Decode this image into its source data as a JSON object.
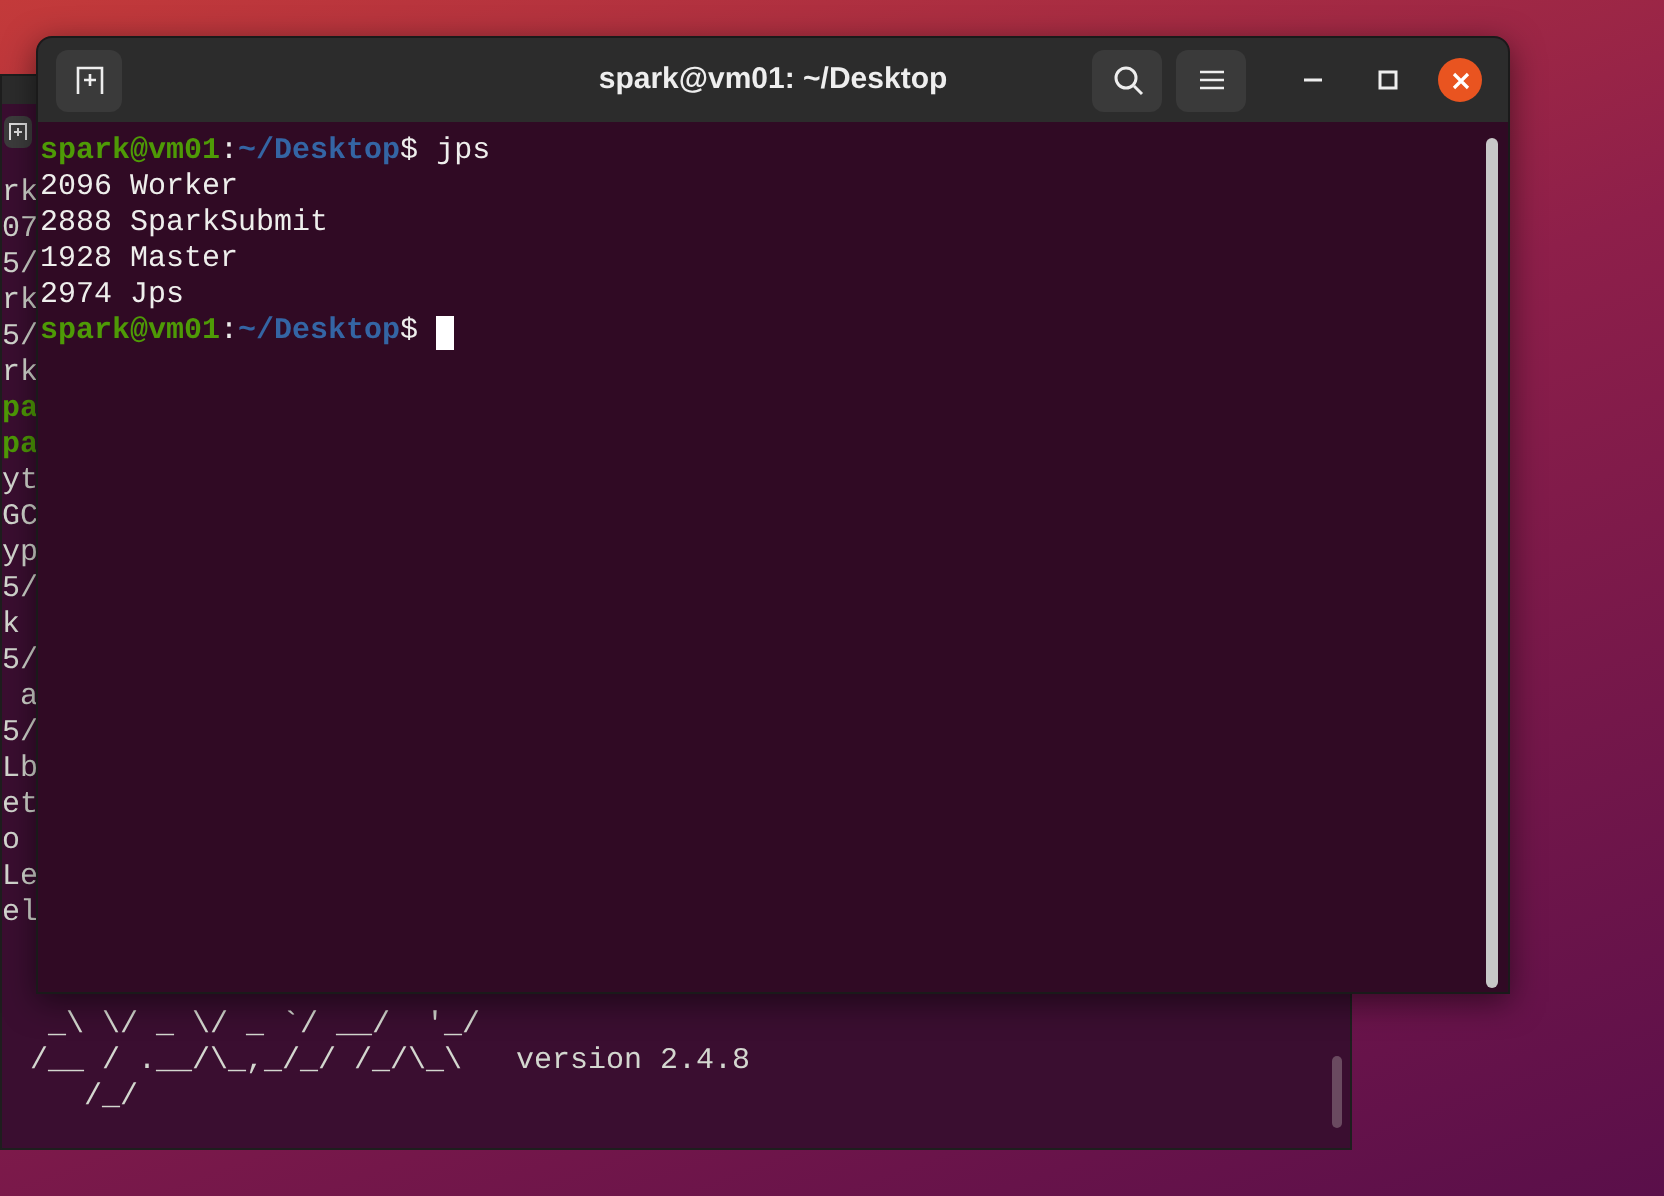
{
  "background_terminal": {
    "lines": [
      {
        "kind": "plain",
        "text": "rk"
      },
      {
        "kind": "plain",
        "text": "07"
      },
      {
        "kind": "plain",
        "text": "5/"
      },
      {
        "kind": "plain",
        "text": "rk"
      },
      {
        "kind": "plain",
        "text": "5/"
      },
      {
        "kind": "plain",
        "text": "rk"
      },
      {
        "kind": "prompt",
        "text": "pa"
      },
      {
        "kind": "prompt",
        "text": "pa"
      },
      {
        "kind": "plain",
        "text": "yt"
      },
      {
        "kind": "plain",
        "text": "GC"
      },
      {
        "kind": "plain",
        "text": "yp"
      },
      {
        "kind": "plain",
        "text": "5/"
      },
      {
        "kind": "plain",
        "text": "k"
      },
      {
        "kind": "plain",
        "text": "5/"
      },
      {
        "kind": "plain",
        "text": " a"
      },
      {
        "kind": "plain",
        "text": "5/"
      },
      {
        "kind": "plain",
        "text": "Lb"
      },
      {
        "kind": "plain",
        "text": "et"
      },
      {
        "kind": "plain",
        "text": "o"
      },
      {
        "kind": "plain",
        "text": "Le"
      },
      {
        "kind": "plain",
        "text": "el"
      }
    ],
    "banner": [
      " _\\ \\/ _ \\/ _ `/ __/  '_/",
      "/__ / .__/\\_,_/_/ /_/\\_\\   version 2.4.8",
      "   /_/"
    ]
  },
  "window": {
    "title": "spark@vm01: ~/Desktop"
  },
  "terminal": {
    "lines": [
      {
        "kind": "prompt",
        "user_host": "spark@vm01",
        "separator": ":",
        "path": "~/Desktop",
        "symbol": "$",
        "command": " jps",
        "cursor": false
      },
      {
        "kind": "output",
        "text": "2096 Worker"
      },
      {
        "kind": "output",
        "text": "2888 SparkSubmit"
      },
      {
        "kind": "output",
        "text": "1928 Master"
      },
      {
        "kind": "output",
        "text": "2974 Jps"
      },
      {
        "kind": "prompt",
        "user_host": "spark@vm01",
        "separator": ":",
        "path": "~/Desktop",
        "symbol": "$",
        "cursor": true
      }
    ]
  }
}
